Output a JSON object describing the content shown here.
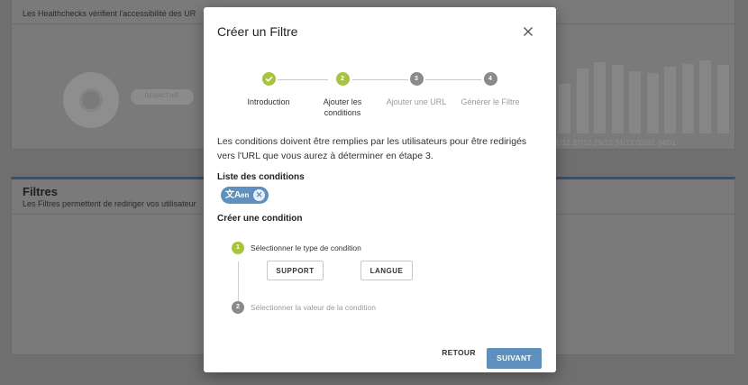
{
  "background": {
    "healthchecks": {
      "subtitle": "Les Healthchecks vérifient l'accessibilité des UR",
      "badge": "DÉSACTIVÉ",
      "axis_labels": "21/12  27/12  29/12  31/12  02/01  04/01",
      "bar_levels": [
        0.62,
        0.82,
        0.9,
        0.86,
        0.78,
        0.76,
        0.84,
        0.88,
        0.92,
        0.86
      ]
    },
    "filtres": {
      "title": "Filtres",
      "subtitle": "Les Filtres permettent de rediriger vos utilisateur"
    }
  },
  "dialog": {
    "title": "Créer un Filtre",
    "close_icon": "close-icon",
    "steps": [
      {
        "number": "",
        "label": "Introduction",
        "state": "done"
      },
      {
        "number": "2",
        "label": "Ajouter les conditions",
        "state": "active"
      },
      {
        "number": "3",
        "label": "Ajouter une URL",
        "state": "todo"
      },
      {
        "number": "4",
        "label": "Générer le Filtre",
        "state": "todo"
      }
    ],
    "description": "Les conditions doivent être remplies par les utilisateurs pour être redirigés vers l'URL que vous aurez à déterminer en étape 3.",
    "conditions_title": "Liste des conditions",
    "chip": {
      "icon": "translate-icon",
      "label": "en"
    },
    "create_title": "Créer une condition",
    "substeps": [
      {
        "number": "1",
        "label": "Sélectionner le type de condition"
      },
      {
        "number": "2",
        "label": "Sélectionner la valeur de la condition"
      }
    ],
    "options": [
      "SUPPORT",
      "LANGUE"
    ],
    "back_label": "RETOUR",
    "next_label": "SUIVANT",
    "colors": {
      "accent_green": "#a8c43a",
      "primary_blue": "#5d8fbf",
      "inactive_grey": "#8a8a8a"
    }
  }
}
